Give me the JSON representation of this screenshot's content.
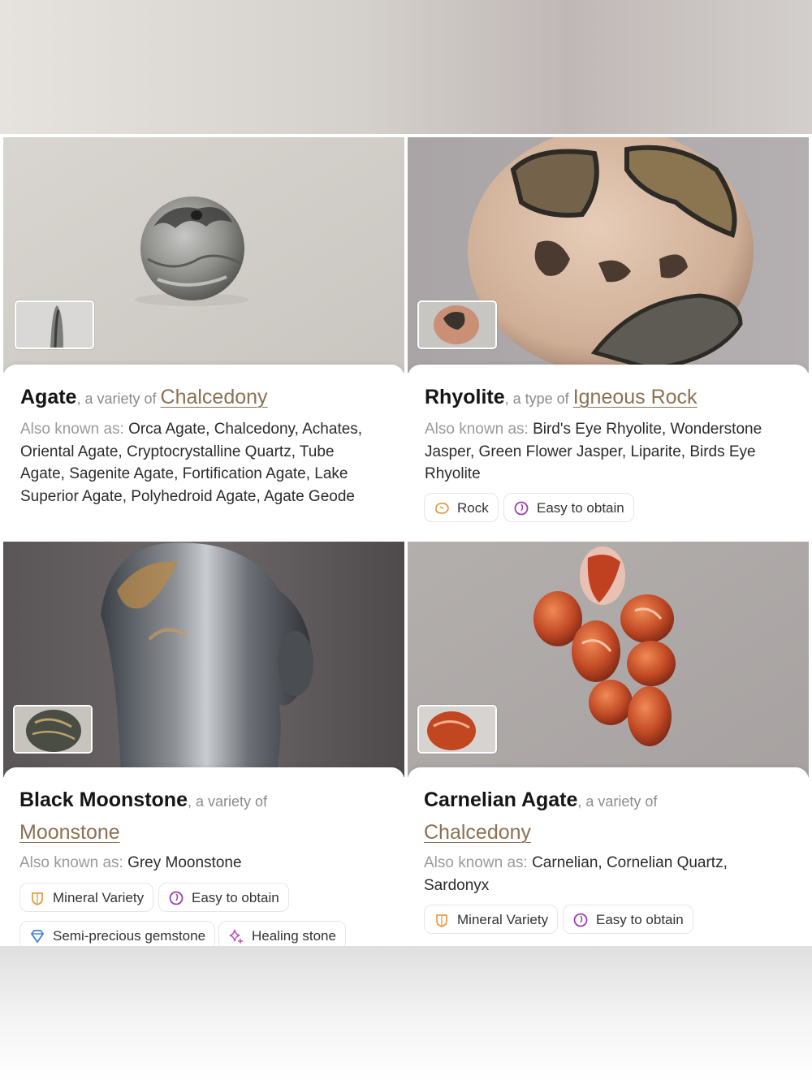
{
  "cards": [
    {
      "name": "Agate",
      "relation": ", a variety of ",
      "parent": "Chalcedony",
      "aka_label": "Also known as: ",
      "aka_value": "Orca Agate, Chalcedony, Achates, Oriental Agate, Cryptocrystalline Quartz, Tube Agate, Sagenite Agate, Fortification Agate, Lake Superior Agate, Polyhedroid Agate, Agate Geode",
      "tags": []
    },
    {
      "name": "Rhyolite",
      "relation": ", a type of ",
      "parent": "Igneous Rock",
      "aka_label": "Also known as: ",
      "aka_value": "Bird's Eye Rhyolite, Wonderstone Jasper, Green Flower Jasper, Liparite, Birds Eye Rhyolite",
      "tags": [
        {
          "label": "Rock",
          "icon": "rock-icon"
        },
        {
          "label": "Easy to obtain",
          "icon": "easy-obtain-icon"
        }
      ]
    },
    {
      "name": "Black Moonstone",
      "relation": ", a variety of",
      "parent": "Moonstone",
      "aka_label": "Also known as: ",
      "aka_value": "Grey Moonstone",
      "tags": [
        {
          "label": "Mineral Variety",
          "icon": "mineral-variety-icon"
        },
        {
          "label": "Easy to obtain",
          "icon": "easy-obtain-icon"
        },
        {
          "label": "Semi-precious gemstone",
          "icon": "gem-icon"
        },
        {
          "label": "Healing stone",
          "icon": "sparkle-icon"
        }
      ]
    },
    {
      "name": "Carnelian Agate",
      "relation": ", a variety of",
      "parent": "Chalcedony",
      "aka_label": "Also known as: ",
      "aka_value": "Carnelian, Cornelian Quartz, Sardonyx",
      "tags": [
        {
          "label": "Mineral Variety",
          "icon": "mineral-variety-icon"
        },
        {
          "label": "Easy to obtain",
          "icon": "easy-obtain-icon"
        }
      ]
    }
  ],
  "colors": {
    "parent_link": "#8b7152",
    "label_gray": "#9a9a9a",
    "rock_icon": "#e0a04a",
    "mineral_icon": "#e0a04a",
    "easy_icon": "#9b3fb5",
    "gem_icon": "#4a7fd0",
    "sparkle_icon": "#c050b8"
  }
}
